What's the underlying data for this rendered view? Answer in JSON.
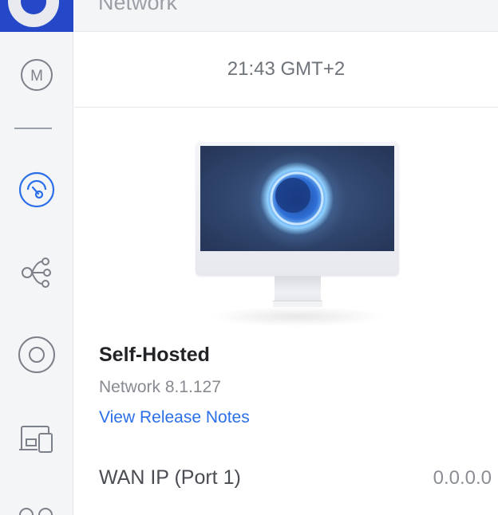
{
  "header": {
    "title": "Network"
  },
  "status": {
    "time": "21:43 GMT+2"
  },
  "sidebar": {
    "items": [
      {
        "icon": "m-circle-icon",
        "label": "M"
      },
      {
        "icon": "network-icon"
      },
      {
        "icon": "topology-icon"
      },
      {
        "icon": "target-circle-icon"
      },
      {
        "icon": "devices-icon"
      },
      {
        "icon": "clients-icon"
      }
    ]
  },
  "device": {
    "name": "Self-Hosted",
    "version": "Network 8.1.127",
    "release_notes_link": "View Release Notes"
  },
  "wan": {
    "label": "WAN IP (Port 1)",
    "value": "0.0.0.0"
  },
  "colors": {
    "accent": "#2a6fe8",
    "brand": "#2448c8"
  }
}
